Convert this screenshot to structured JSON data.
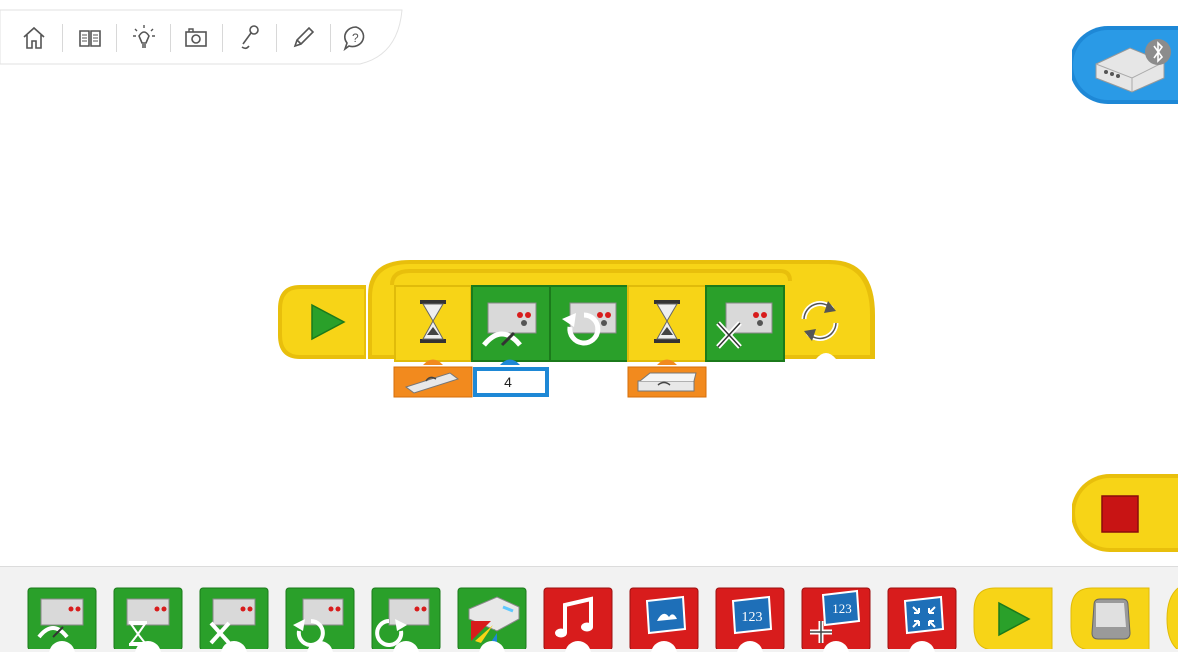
{
  "toolbar": {
    "items": [
      "home-icon",
      "book-icon",
      "lightbulb-icon",
      "camera-icon",
      "microphone-icon",
      "pencil-icon",
      "help-icon"
    ]
  },
  "hub": {
    "connection_icon": "bluetooth-icon",
    "colors": {
      "bg": "#1e88d6"
    }
  },
  "program": {
    "start_block": "play-start",
    "loop_end_icon": "repeat-icon",
    "blocks": [
      {
        "name": "wait-block",
        "input": "tilt-sensor-input"
      },
      {
        "name": "motor-power-block",
        "input": "number-input",
        "value": "4"
      },
      {
        "name": "motor-direction-block"
      },
      {
        "name": "wait-block",
        "input": "motion-sensor-input"
      },
      {
        "name": "motor-stop-block"
      }
    ]
  },
  "palette": {
    "blocks": [
      "motor-power",
      "motor-on-for",
      "motor-stop",
      "motor-this-way",
      "motor-that-way",
      "light",
      "play-sound",
      "display-background",
      "display-number",
      "add-to-display",
      "display-small",
      "start-block",
      "key-start",
      "more"
    ]
  },
  "colors": {
    "green": "#2aa02a",
    "yellow": "#f7d417",
    "red": "#d81c1c",
    "orange": "#f28a1e",
    "blue": "#1e88d6"
  }
}
